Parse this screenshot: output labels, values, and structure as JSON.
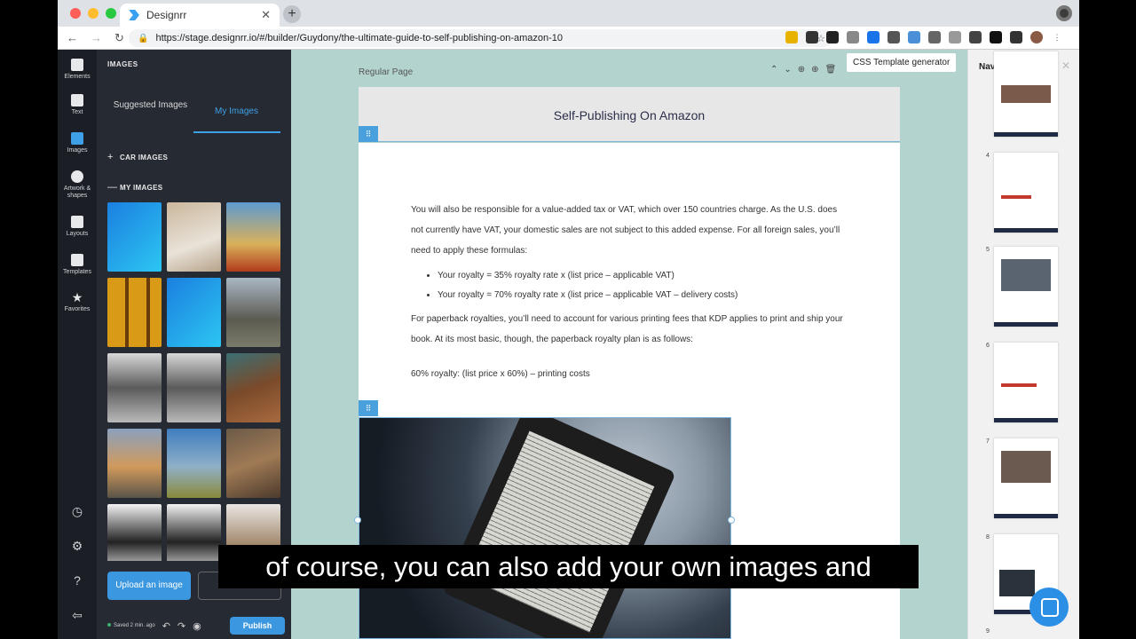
{
  "browser": {
    "tab_title": "Designrr",
    "url": "https://stage.designrr.io/#/builder/Guydony/the-ultimate-guide-to-self-publishing-on-amazon-10"
  },
  "iconbar": {
    "items": [
      "Elements",
      "Text",
      "Images",
      "Artwork & shapes",
      "Layouts",
      "Templates",
      "Favorites"
    ]
  },
  "panel": {
    "title": "IMAGES",
    "tab_suggested": "Suggested Images",
    "tab_my": "My Images",
    "section_car": "CAR IMAGES",
    "section_my": "MY IMAGES",
    "upload_label": "Upload an image",
    "saved": "Saved 2 min. ago",
    "publish": "Publish"
  },
  "canvas": {
    "page_type": "Regular Page",
    "tooltip": "CSS Template generator",
    "title": "Self-Publishing On Amazon",
    "para1": "You will also be responsible for a value-added tax or VAT, which over 150 countries charge. As the U.S. does not currently have VAT, your domestic sales are not subject to this added expense.  For all foreign sales, you’ll need to apply these formulas:",
    "bullets": [
      "Your royalty = 35% royalty rate x (list price – applicable VAT)",
      "Your royalty = 70% royalty rate x (list price – applicable VAT – delivery costs)"
    ],
    "para2": "For paperback royalties, you’ll need to account for various printing fees that  KDP applies to print and ship your book. At its most basic, though, the paperback royalty plan is as follows:",
    "para3": "60% royalty: (list price x 60%) – printing costs"
  },
  "navigator": {
    "title": "Navigator",
    "pages": [
      "4",
      "5",
      "6",
      "7",
      "8",
      "9"
    ]
  },
  "caption": "of course, you can also add your own images and"
}
